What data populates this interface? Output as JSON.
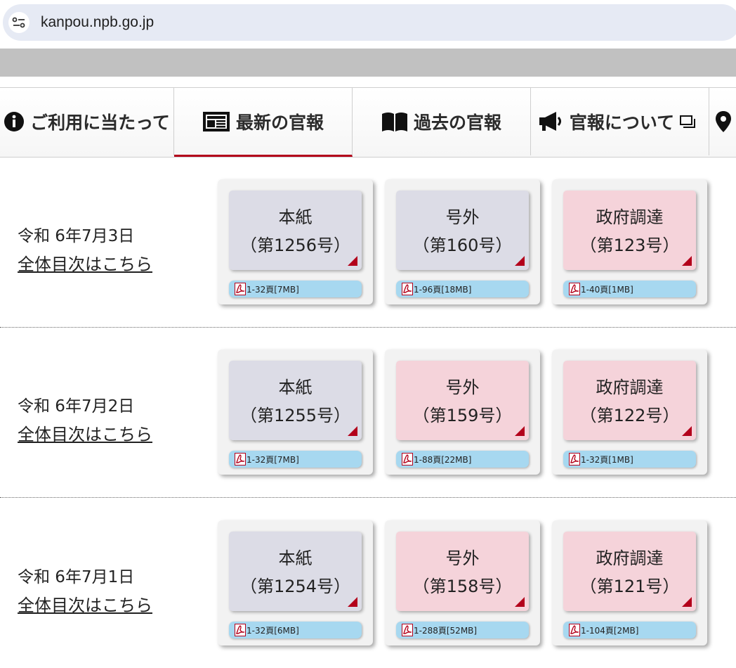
{
  "browser": {
    "url": "kanpou.npb.go.jp"
  },
  "nav": [
    {
      "label": "ご利用に当たって",
      "icon": "info-icon"
    },
    {
      "label": "最新の官報",
      "icon": "newspaper-icon",
      "active": true
    },
    {
      "label": "過去の官報",
      "icon": "book-icon"
    },
    {
      "label": "官報について",
      "icon": "megaphone-icon",
      "external": "new-window-icon"
    },
    {
      "label": "",
      "icon": "map-pin-icon"
    }
  ],
  "rows": [
    {
      "date": "令和 6年7月3日",
      "toc": "全体目次はこちら",
      "cards": [
        {
          "title": "本紙",
          "number": "（第1256号）",
          "pdf": "1-32頁[7MB]",
          "color": "#dcdce6"
        },
        {
          "title": "号外",
          "number": "（第160号）",
          "pdf": "1-96頁[18MB]",
          "color": "#dcdce6"
        },
        {
          "title": "政府調達",
          "number": "（第123号）",
          "pdf": "1-40頁[1MB]",
          "color": "#f5d3da"
        }
      ]
    },
    {
      "date": "令和 6年7月2日",
      "toc": "全体目次はこちら",
      "cards": [
        {
          "title": "本紙",
          "number": "（第1255号）",
          "pdf": "1-32頁[7MB]",
          "color": "#dcdce6"
        },
        {
          "title": "号外",
          "number": "（第159号）",
          "pdf": "1-88頁[22MB]",
          "color": "#f5d3da"
        },
        {
          "title": "政府調達",
          "number": "（第122号）",
          "pdf": "1-32頁[1MB]",
          "color": "#f5d3da"
        }
      ]
    },
    {
      "date": "令和 6年7月1日",
      "toc": "全体目次はこちら",
      "cards": [
        {
          "title": "本紙",
          "number": "（第1254号）",
          "pdf": "1-32頁[6MB]",
          "color": "#dcdce6"
        },
        {
          "title": "号外",
          "number": "（第158号）",
          "pdf": "1-288頁[52MB]",
          "color": "#f5d3da"
        },
        {
          "title": "政府調達",
          "number": "（第121号）",
          "pdf": "1-104頁[2MB]",
          "color": "#f5d3da"
        }
      ]
    }
  ],
  "colors": {
    "accent": "#b3001b",
    "pdf_bar": "#a7d8f0",
    "card_grey": "#dcdce6",
    "card_pink": "#f5d3da"
  }
}
